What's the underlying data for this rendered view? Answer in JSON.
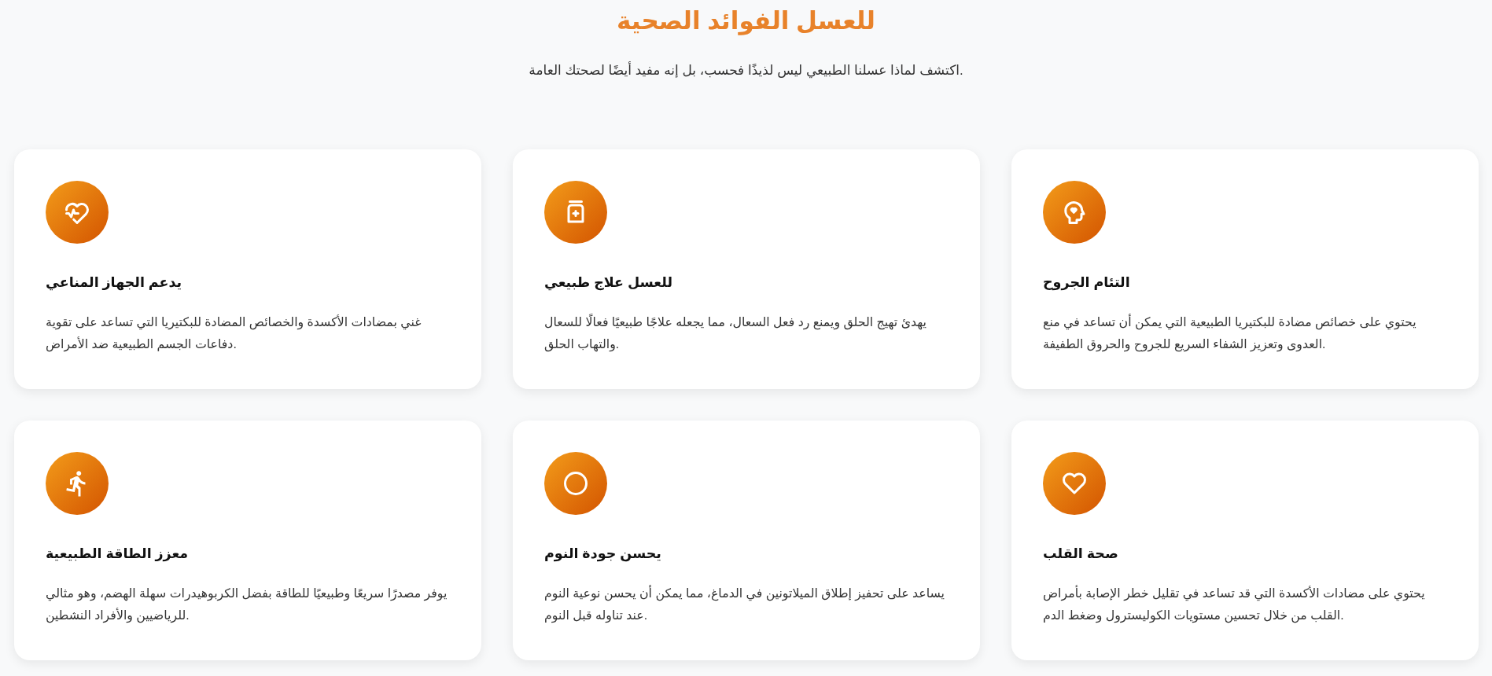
{
  "header": {
    "title": "للعسل الفوائد الصحية",
    "subtitle": "اكتشف لماذا عسلنا الطبيعي ليس لذيذًا فحسب، بل إنه مفيد أيضًا لصحتك العامة."
  },
  "benefits": [
    {
      "title": "التئام الجروح",
      "description": "يحتوي على خصائص مضادة للبكتيريا الطبيعية التي يمكن أن تساعد في منع العدوى وتعزيز الشفاء السريع للجروح والحروق الطفيفة."
    },
    {
      "title": "للعسل علاج طبيعي",
      "description": "يهدئ تهيج الحلق ويمنع رد فعل السعال، مما يجعله علاجًا طبيعيًا فعالًا للسعال والتهاب الحلق."
    },
    {
      "title": "يدعم الجهاز المناعي",
      "description": "غني بمضادات الأكسدة والخصائص المضادة للبكتيريا التي تساعد على تقوية دفاعات الجسم الطبيعية ضد الأمراض."
    },
    {
      "title": "صحة القلب",
      "description": "يحتوي على مضادات الأكسدة التي قد تساعد في تقليل خطر الإصابة بأمراض القلب من خلال تحسين مستويات الكوليسترول وضغط الدم."
    },
    {
      "title": "يحسن جودة النوم",
      "description": "يساعد على تحفيز إطلاق الميلاتونين في الدماغ، مما يمكن أن يحسن نوعية النوم عند تناوله قبل النوم."
    },
    {
      "title": "معزز الطاقة الطبيعية",
      "description": "يوفر مصدرًا سريعًا وطبيعيًا للطاقة بفضل الكربوهيدرات سهلة الهضم، وهو مثالي للرياضيين والأفراد النشطين."
    }
  ]
}
